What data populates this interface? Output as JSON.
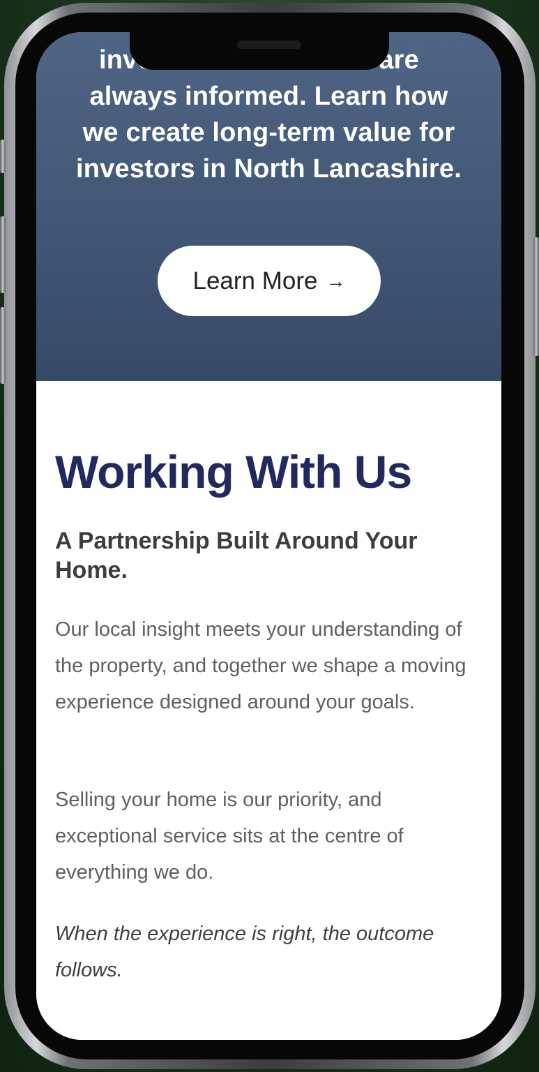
{
  "hero": {
    "text_lines": [
      "inve",
      "s are",
      "always informed. Learn how",
      "we create long-term value for",
      "investors in North Lancashire."
    ],
    "button_label": "Learn More",
    "button_arrow": "→"
  },
  "section": {
    "title": "Working With Us",
    "subtitle": "A Partnership Built Around Your Home.",
    "paragraphs": [
      "Our local insight meets your understanding of the property, and together we shape a moving experience designed around your goals.",
      "Selling your home is our priority, and exceptional service sits at the centre of everything we do.",
      "When the experience is right, the outcome follows."
    ]
  },
  "colors": {
    "hero_bg": "#3f5679",
    "title": "#23295f",
    "body_text": "#5f5f5f",
    "backdrop": "#1f3a1d"
  }
}
